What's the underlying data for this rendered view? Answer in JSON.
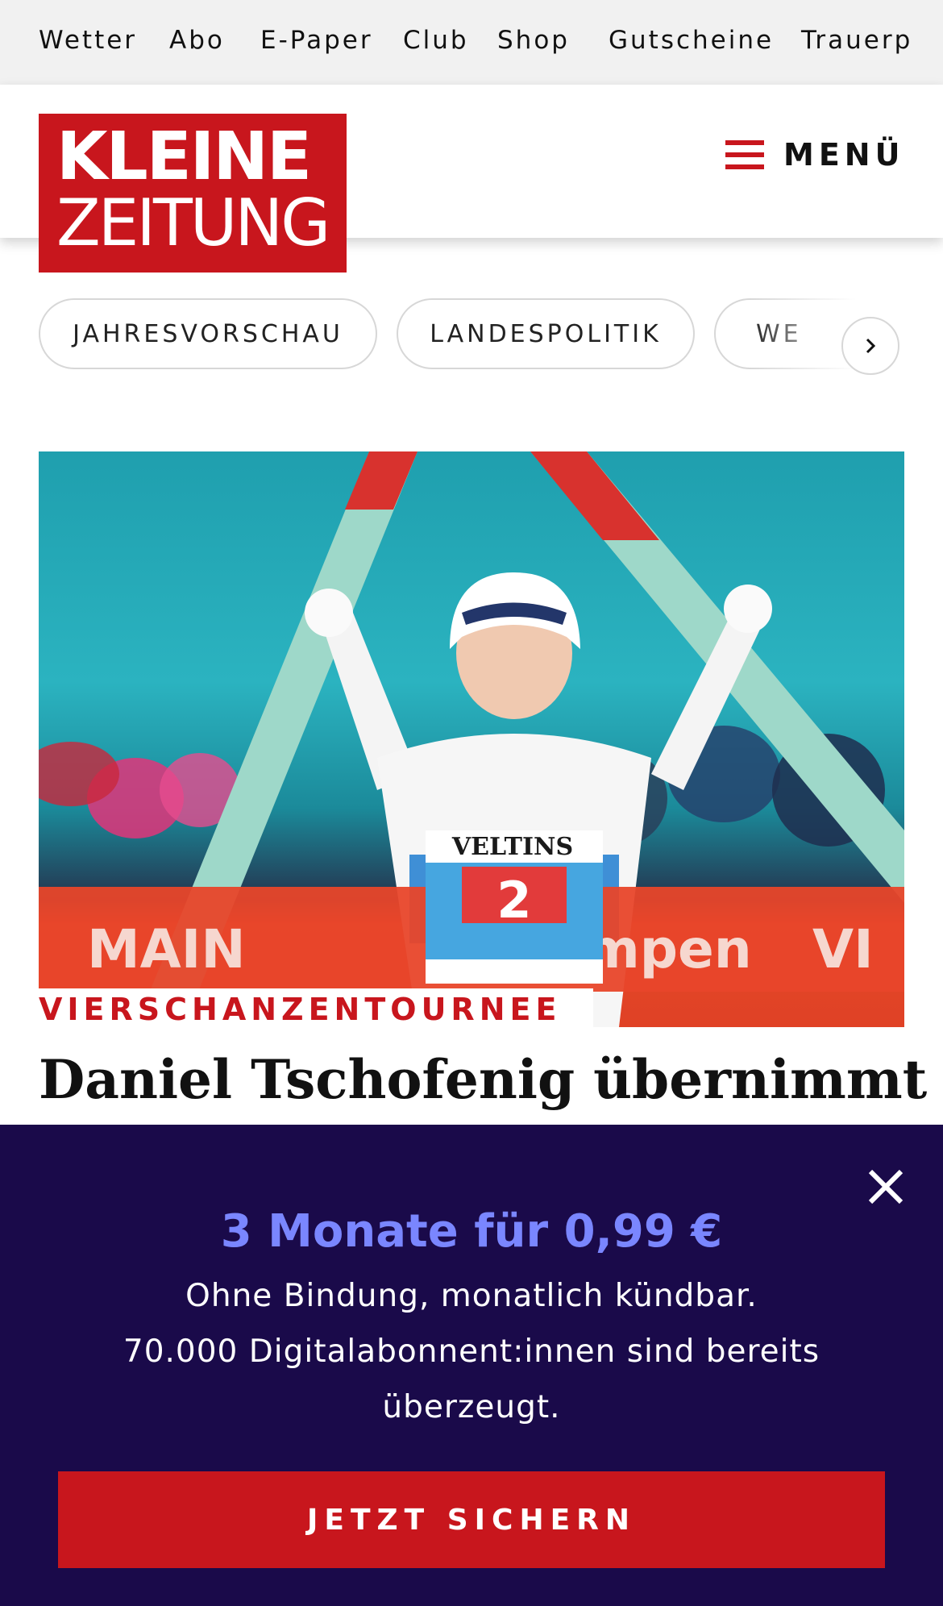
{
  "topnav": {
    "items": [
      "Wetter",
      "Abo",
      "E-Paper",
      "Club",
      "Shop",
      "Gutscheine",
      "Trauerp"
    ]
  },
  "header": {
    "logo_line1": "KLEINE",
    "logo_line2": "ZEITUNG",
    "menu_label": "MENÜ"
  },
  "topics": {
    "chips": [
      "JAHRESVORSCHAU",
      "LANDESPOLITIK",
      "WE"
    ]
  },
  "teaser": {
    "kicker": "VIERSCHANZENTOURNEE",
    "headline": "Daniel Tschofenig übernimmt",
    "image_texts": {
      "bib_number": "2",
      "sponsor": "VELTINS",
      "banner_left": "MAIN",
      "banner_mid": "umpen",
      "banner_right": "VI"
    }
  },
  "promo": {
    "title": "3 Monate für 0,99 €",
    "line1": "Ohne Bindung, monatlich kündbar.",
    "line2": "70.000 Digitalabonnent:innen sind bereits überzeugt.",
    "cta": "JETZT SICHERN"
  },
  "colors": {
    "brand_red": "#c8161d",
    "promo_bg": "#1a0a4a",
    "promo_accent": "#7a86ff"
  }
}
